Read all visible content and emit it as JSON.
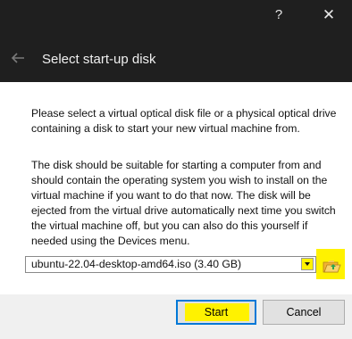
{
  "window": {
    "help_label": "?",
    "close_label": "✕"
  },
  "wizard": {
    "title": "Select start-up disk",
    "back_icon": "back-arrow-icon"
  },
  "content": {
    "paragraph1": "Please select a virtual optical disk file or a physical optical drive containing a disk to start your new virtual machine from.",
    "paragraph2": "The disk should be suitable for starting a computer from and should contain the operating system you wish to install on the virtual machine if you want to do that now. The disk will be ejected from the virtual drive automatically next time you switch the virtual machine off, but you can also do this yourself if needed using the Devices menu."
  },
  "disk_selector": {
    "selected": "ubuntu-22.04-desktop-amd64.iso (3.40 GB)",
    "folder_icon": "folder-open-icon"
  },
  "buttons": {
    "start": "Start",
    "cancel": "Cancel"
  },
  "colors": {
    "highlight": "#fff200",
    "titlebar": "#1f1f1f",
    "focus": "#0078d7"
  }
}
